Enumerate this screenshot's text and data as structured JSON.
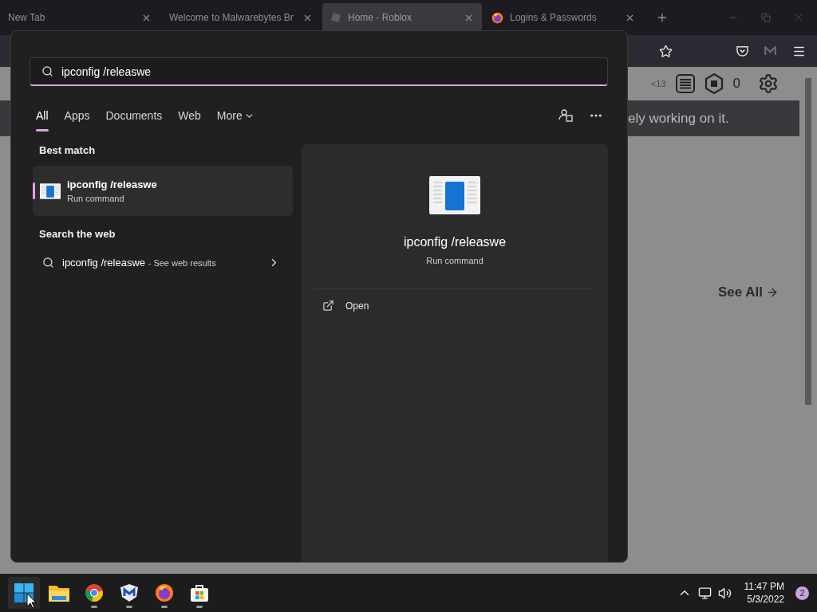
{
  "browser": {
    "tabs": [
      {
        "label": "New Tab",
        "kind": "plain",
        "selected": false
      },
      {
        "label": "Welcome to Malwarebytes Br",
        "kind": "plain",
        "selected": false
      },
      {
        "label": "Home - Roblox",
        "kind": "roblox",
        "selected": true
      },
      {
        "label": "Logins & Passwords",
        "kind": "firefox",
        "selected": false
      }
    ],
    "page": {
      "friends_count": "<13",
      "robux": "0",
      "banner": "ely working on it.",
      "see_all": "See All"
    }
  },
  "search": {
    "query": "ipconfig /releaswe",
    "filters": [
      {
        "label": "All",
        "kind": "tab",
        "selected": true
      },
      {
        "label": "Apps",
        "kind": "tab",
        "selected": false
      },
      {
        "label": "Documents",
        "kind": "tab",
        "selected": false
      },
      {
        "label": "Web",
        "kind": "tab",
        "selected": false
      },
      {
        "label": "More",
        "kind": "dropdown",
        "selected": false
      }
    ],
    "best_match": {
      "heading": "Best match",
      "title": "ipconfig /releaswe",
      "subtitle": "Run command",
      "selected": true
    },
    "web": {
      "heading": "Search the web",
      "query": "ipconfig /releaswe",
      "suffix": "- See web results"
    },
    "preview": {
      "title": "ipconfig /releaswe",
      "subtitle": "Run command",
      "actions": [
        "Open"
      ]
    }
  },
  "taskbar": {
    "apps": [
      {
        "kind": "start",
        "running": false
      },
      {
        "kind": "explorer",
        "running": false
      },
      {
        "kind": "chrome",
        "running": true
      },
      {
        "kind": "malwarebytes",
        "running": true
      },
      {
        "kind": "firefox",
        "running": true
      },
      {
        "kind": "store",
        "running": true
      }
    ],
    "clock": {
      "time": "11:47 PM",
      "date": "5/3/2022"
    },
    "notifications": "2"
  }
}
